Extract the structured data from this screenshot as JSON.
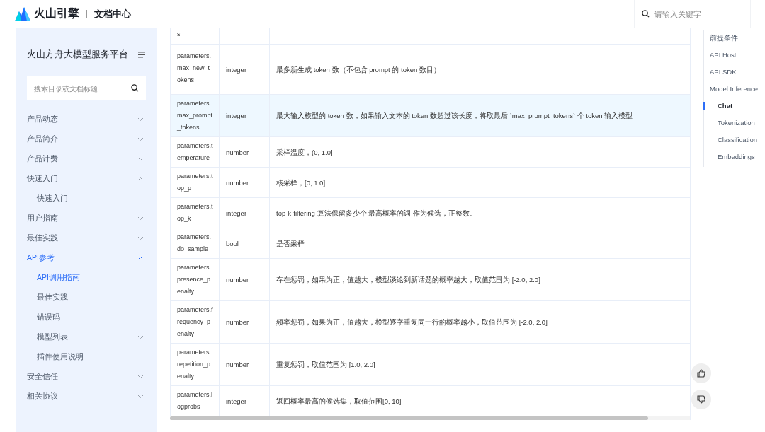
{
  "header": {
    "logo_text": "火山引擎",
    "section": "文档中心",
    "search_placeholder": "请输入关键字"
  },
  "sidebar": {
    "title": "火山方舟大模型服务平台",
    "search_placeholder": "搜索目录或文档标题",
    "items": [
      {
        "label": "产品动态",
        "expanded": false,
        "selected": false
      },
      {
        "label": "产品简介",
        "expanded": false,
        "selected": false
      },
      {
        "label": "产品计费",
        "expanded": false,
        "selected": false
      },
      {
        "label": "快速入门",
        "expanded": true,
        "selected": false,
        "children": [
          {
            "label": "快速入门",
            "selected": false
          }
        ]
      },
      {
        "label": "用户指南",
        "expanded": false,
        "selected": false
      },
      {
        "label": "最佳实践",
        "expanded": false,
        "selected": false
      },
      {
        "label": "API参考",
        "expanded": true,
        "selected": true,
        "children": [
          {
            "label": "API调用指南",
            "selected": true
          },
          {
            "label": "最佳实践",
            "selected": false
          },
          {
            "label": "错误码",
            "selected": false
          },
          {
            "label": "模型列表",
            "expanded": false,
            "selected": false
          },
          {
            "label": "插件使用说明",
            "selected": false
          }
        ]
      },
      {
        "label": "安全信任",
        "expanded": false,
        "selected": false
      },
      {
        "label": "相关协议",
        "expanded": false,
        "selected": false
      }
    ]
  },
  "table": {
    "partial_row": {
      "name": "s"
    },
    "rows": [
      {
        "name": "parameters.max_new_tokens",
        "type": "integer",
        "description": "最多新生成 token 数（不包含 prompt 的 token 数目）",
        "highlighted": false
      },
      {
        "name": "parameters.max_prompt_tokens",
        "type": "integer",
        "description": "最大输入模型的 token 数，如果输入文本的 token 数超过该长度，将取最后 `max_prompt_tokens` 个 token 输入模型",
        "highlighted": true
      },
      {
        "name": "parameters.temperature",
        "type": "number",
        "description": "采样温度，(0,  1.0]",
        "highlighted": false
      },
      {
        "name": "parameters.top_p",
        "type": "number",
        "description": "核采样，[0,  1.0]",
        "highlighted": false
      },
      {
        "name": "parameters.top_k",
        "type": "integer",
        "description": "top-k-filtering 算法保留多少个 最高概率的词 作为候选，正整数。",
        "highlighted": false
      },
      {
        "name": "parameters.do_sample",
        "type": "bool",
        "description": "是否采样",
        "highlighted": false
      },
      {
        "name": "parameters.presence_penalty",
        "type": "number",
        "description": "存在惩罚，如果为正，值越大，模型谈论到新话题的概率越大，取值范围为 [-2.0, 2.0]",
        "highlighted": false
      },
      {
        "name": "parameters.frequency_penalty",
        "type": "number",
        "description": "频率惩罚，如果为正，值越大，模型逐字重复同一行的概率越小，取值范围为 [-2.0, 2.0]",
        "highlighted": false
      },
      {
        "name": "parameters.repetition_penalty",
        "type": "number",
        "description": "重复惩罚，取值范围为 [1.0, 2.0]",
        "highlighted": false
      },
      {
        "name": "parameters.logprobs",
        "type": "integer",
        "description": "返回概率最高的候选集，取值范围[0, 10]",
        "highlighted": false
      }
    ]
  },
  "toc": [
    {
      "label": "前提条件",
      "selected": false
    },
    {
      "label": "API Host",
      "selected": false
    },
    {
      "label": "API SDK",
      "selected": false
    },
    {
      "label": "Model Inference",
      "selected": false,
      "children": [
        {
          "label": "Chat",
          "selected": true
        },
        {
          "label": "Tokenization",
          "selected": false
        },
        {
          "label": "Classification",
          "selected": false
        },
        {
          "label": "Embeddings",
          "selected": false
        }
      ]
    }
  ]
}
